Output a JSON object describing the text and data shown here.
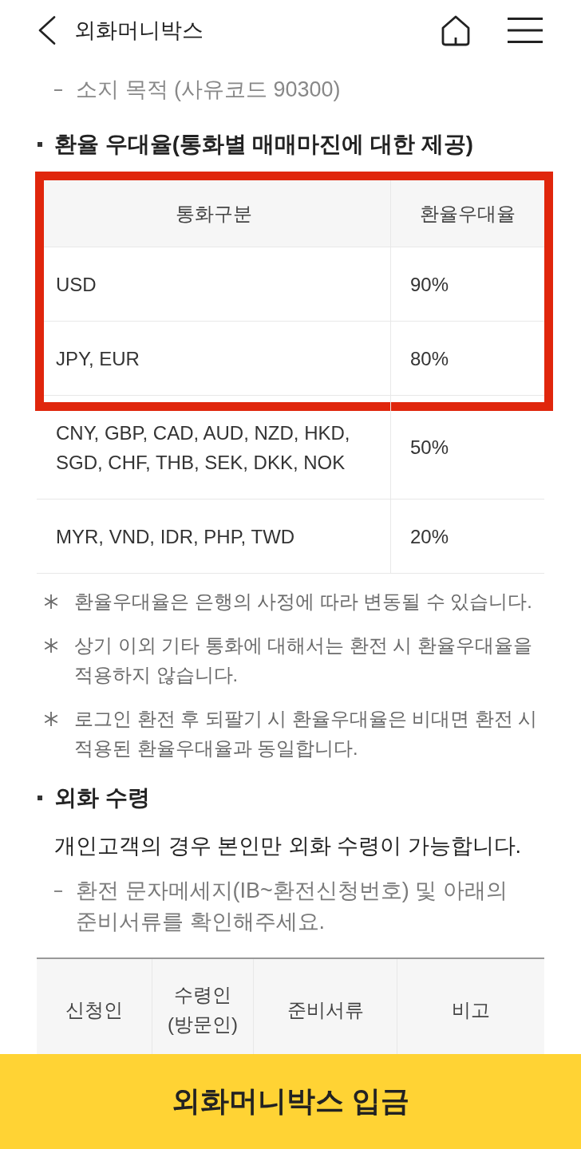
{
  "header": {
    "title": "외화머니박스"
  },
  "intro_items": [
    "소지 목적 (사유코드 90300)"
  ],
  "rate_section": {
    "heading": "환율 우대율(통화별 매매마진에 대한 제공)",
    "table": {
      "columns": [
        "통화구분",
        "환율우대율"
      ],
      "header_highlighted": true,
      "rows": [
        {
          "currencies": "USD",
          "rate": "90%",
          "highlighted": true
        },
        {
          "currencies": "JPY, EUR",
          "rate": "80%",
          "highlighted": true
        },
        {
          "currencies": "CNY, GBP, CAD, AUD, NZD, HKD, SGD, CHF, THB, SEK, DKK, NOK",
          "rate": "50%",
          "highlighted": false
        },
        {
          "currencies": "MYR, VND, IDR, PHP, TWD",
          "rate": "20%",
          "highlighted": false
        }
      ]
    },
    "notes": [
      "환율우대율은 은행의 사정에 따라 변동될 수 있습니다.",
      "상기 이외 기타 통화에 대해서는 환전 시 환율우대율을 적용하지 않습니다.",
      "로그인 환전 후 되팔기 시 환율우대율은 비대면 환전 시 적용된 환율우대율과 동일합니다."
    ]
  },
  "receipt_section": {
    "heading": "외화 수령",
    "paragraph": "개인고객의 경우 본인만 외화 수령이 가능합니다.",
    "items": [
      "환전 문자메세지(IB~환전신청번호) 및 아래의 준비서류를 확인해주세요."
    ],
    "table": {
      "columns": [
        "신청인",
        "수령인 (방문인)",
        "준비서류",
        "비고"
      ]
    }
  },
  "deposit_button": {
    "label": "외화머니박스 입금"
  }
}
